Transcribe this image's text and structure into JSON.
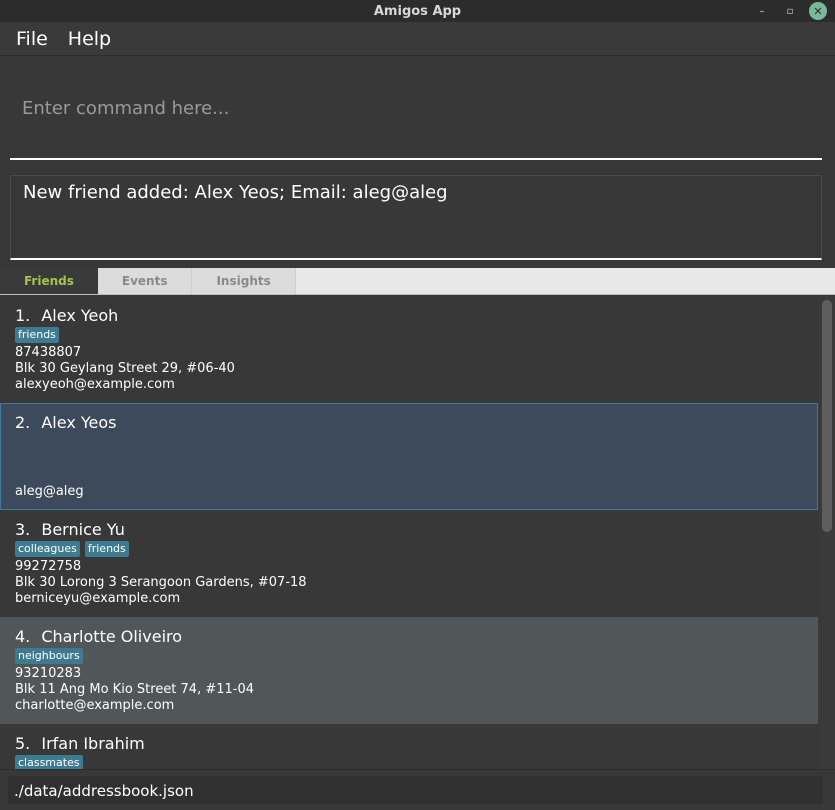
{
  "window": {
    "title": "Amigos App",
    "minimize_label": "–",
    "maximize_label": "▫",
    "close_label": "✕"
  },
  "menu": {
    "file_label": "File",
    "help_label": "Help"
  },
  "command": {
    "placeholder": "Enter command here...",
    "value": ""
  },
  "result": {
    "message": "New friend added: Alex Yeos; Email: aleg@aleg"
  },
  "tabs": [
    {
      "label": "Friends",
      "active": true
    },
    {
      "label": "Events",
      "active": false
    },
    {
      "label": "Insights",
      "active": false
    }
  ],
  "friends": [
    {
      "index": "1.",
      "name": "Alex Yeoh",
      "tags": [
        "friends"
      ],
      "phone": "87438807",
      "address": "Blk 30 Geylang Street 29, #06-40",
      "email": "alexyeoh@example.com"
    },
    {
      "index": "2.",
      "name": "Alex Yeos",
      "tags": [],
      "phone": "",
      "address": "",
      "email": "aleg@aleg"
    },
    {
      "index": "3.",
      "name": "Bernice Yu",
      "tags": [
        "colleagues",
        "friends"
      ],
      "phone": "99272758",
      "address": "Blk 30 Lorong 3 Serangoon Gardens, #07-18",
      "email": "berniceyu@example.com"
    },
    {
      "index": "4.",
      "name": "Charlotte Oliveiro",
      "tags": [
        "neighbours"
      ],
      "phone": "93210283",
      "address": "Blk 11 Ang Mo Kio Street 74, #11-04",
      "email": "charlotte@example.com"
    },
    {
      "index": "5.",
      "name": "Irfan Ibrahim",
      "tags": [
        "classmates"
      ],
      "phone": "",
      "address": "",
      "email": ""
    }
  ],
  "status": {
    "file_path": "./data/addressbook.json"
  },
  "colors": {
    "background": "#383838",
    "tag": "#3e7b91",
    "selected_card": "#3c4a5c",
    "active_tab_text": "#a7c34e"
  }
}
